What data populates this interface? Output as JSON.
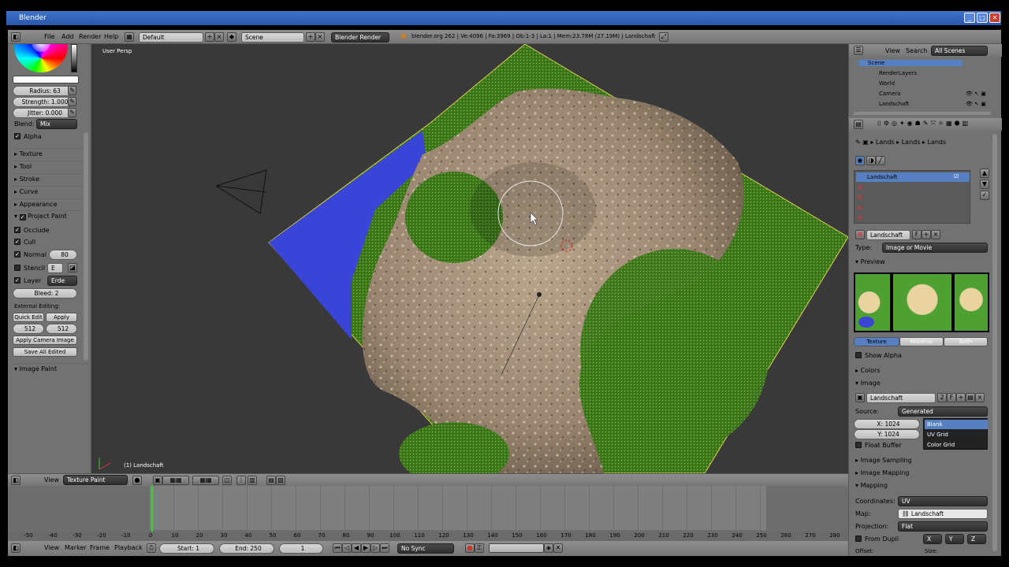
{
  "app": {
    "title": "Blender"
  },
  "menu": {
    "file": "File",
    "add": "Add",
    "render": "Render",
    "help": "Help"
  },
  "header": {
    "layout": "Default",
    "scene": "Scene",
    "engine": "Blender Render",
    "stats": "blender.org 262 | Ve:4096 | Fa:3969 | Ob:1-3 | La:1 | Mem:23.78M (27.19M) | Landschaft"
  },
  "toolshelf": {
    "radius": "Radius: 63",
    "strength": "Strength: 1.000",
    "jitter": "Jitter: 0.000",
    "blend_label": "Blend:",
    "blend_value": "Mix",
    "alpha": "Alpha",
    "sections": [
      "Texture",
      "Tool",
      "Stroke",
      "Curve",
      "Appearance"
    ],
    "project_paint": "Project Paint",
    "occlude": "Occlude",
    "cull": "Cull",
    "normal": "Normal",
    "normal_value": "80",
    "stencil": "Stencil",
    "stencil_value": "E",
    "layer": "Layer",
    "layer_value": "Erde",
    "bleed": "Bleed: 2",
    "external_editing": "External Editing:",
    "quick_edit": "Quick Edit",
    "apply": "Apply",
    "size_x": "512",
    "size_y": "512",
    "apply_camera": "Apply Camera Image",
    "save_all": "Save All Edited",
    "image_paint": "Image Paint"
  },
  "viewport": {
    "persp": "User Persp",
    "object_name": "(1) Landschaft"
  },
  "view_header": {
    "view": "View",
    "mode": "Texture Paint"
  },
  "timeline": {
    "ticks": [
      "-50",
      "-40",
      "-30",
      "-20",
      "-10",
      "0",
      "10",
      "20",
      "30",
      "40",
      "50",
      "60",
      "70",
      "80",
      "90",
      "100",
      "110",
      "120",
      "130",
      "140",
      "150",
      "160",
      "170",
      "180",
      "190",
      "200",
      "210",
      "220",
      "230",
      "240",
      "250",
      "260",
      "270",
      "280"
    ],
    "view": "View",
    "marker": "Marker",
    "frame": "Frame",
    "playback": "Playback",
    "start": "Start: 1",
    "end": "End: 250",
    "current": "1",
    "sync": "No Sync"
  },
  "outliner": {
    "view": "View",
    "search": "Search",
    "scenes": "All Scenes",
    "items": [
      "Scene",
      "RenderLayers",
      "World",
      "Camera",
      "Landschaft"
    ]
  },
  "properties": {
    "breadcrumb": [
      "Lands",
      "Lands",
      "Lands"
    ],
    "texture_slot": "Landschaft",
    "texture_name": "Landschaft",
    "type_label": "Type:",
    "type_value": "Image or Movie",
    "preview": "Preview",
    "tabs": [
      "Texture",
      "Material",
      "Both"
    ],
    "show_alpha": "Show Alpha",
    "colors": "Colors",
    "image": "Image",
    "image_name": "Landschaft",
    "image_users": "2",
    "fake_user": "F",
    "source_label": "Source:",
    "source_value": "Generated",
    "x": "X: 1024",
    "y": "Y: 1024",
    "gen_types": [
      "Blank",
      "UV Grid",
      "Color Grid"
    ],
    "float_buffer": "Float Buffer",
    "image_sampling": "Image Sampling",
    "image_mapping": "Image Mapping",
    "mapping": "Mapping",
    "coordinates_label": "Coordinates:",
    "coordinates_value": "UV",
    "map_label": "Map:",
    "map_value": "Landschaft",
    "projection_label": "Projection:",
    "projection_value": "Flat",
    "from_dupli": "From Dupli",
    "x_axis": "X",
    "y_axis": "Y",
    "z_axis": "Z",
    "offset": "Offset:",
    "size": "Size:"
  },
  "colors": {
    "selection": "#5680c2",
    "panel": "#727272",
    "viewport": "#393939",
    "frame_marker": "#3cd23c"
  }
}
